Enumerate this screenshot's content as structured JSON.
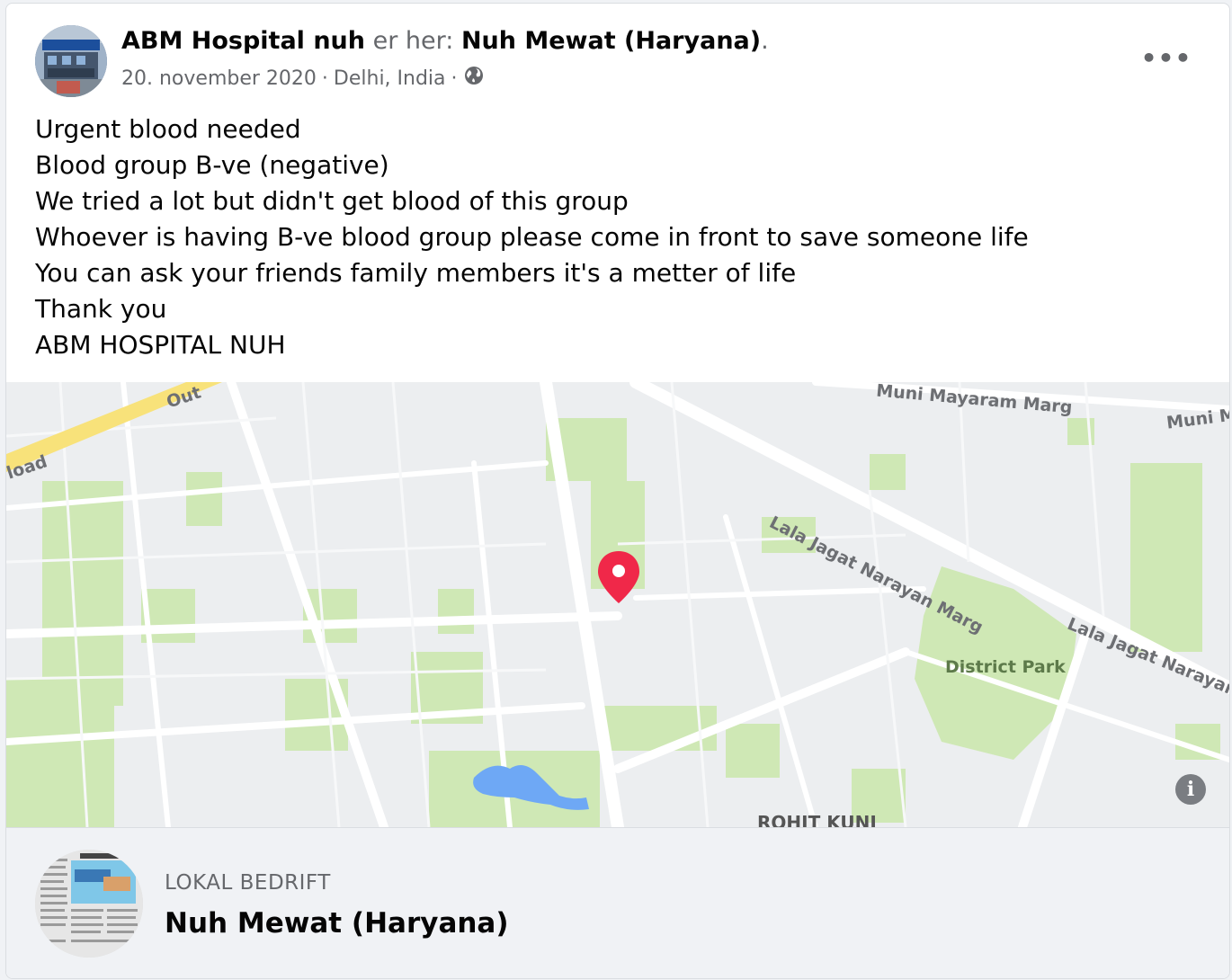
{
  "post": {
    "author": "ABM Hospital nuh",
    "connector": "er her:",
    "place": "Nuh Mewat (Haryana)",
    "period": ".",
    "date": "20. november 2020",
    "location": "Delhi, India",
    "separator": "·",
    "privacy_icon": "globe-icon",
    "more_icon": "more-options-icon",
    "more_label": "•••",
    "lines": [
      "Urgent blood needed",
      "Blood group B-ve (negative)",
      "We tried a lot but didn't get blood of this group",
      "Whoever is having B-ve blood group please come in front to save someone life",
      "You can ask your friends family members it's a metter of life",
      "Thank you",
      "ABM HOSPITAL NUH"
    ]
  },
  "map": {
    "labels": {
      "road_top": "Muni Mayaram Marg",
      "road_top_right": "Muni M",
      "road_diag_1": "Lala Jagat Narayan Marg",
      "road_diag_2": "Lala Jagat Narayan",
      "road_left": "load",
      "road_left_top": "Out",
      "park": "District Park",
      "area": "ROHIT KUNJ"
    },
    "pin_color": "#f02849",
    "info_label": "i"
  },
  "footer": {
    "category": "LOKAL BEDRIFT",
    "name": "Nuh Mewat (Haryana)"
  },
  "colors": {
    "text_primary": "#050505",
    "text_secondary": "#65676b",
    "park_green": "#cfe8b5",
    "road_yellow": "#f8e27a",
    "water_blue": "#6ea8f5"
  }
}
